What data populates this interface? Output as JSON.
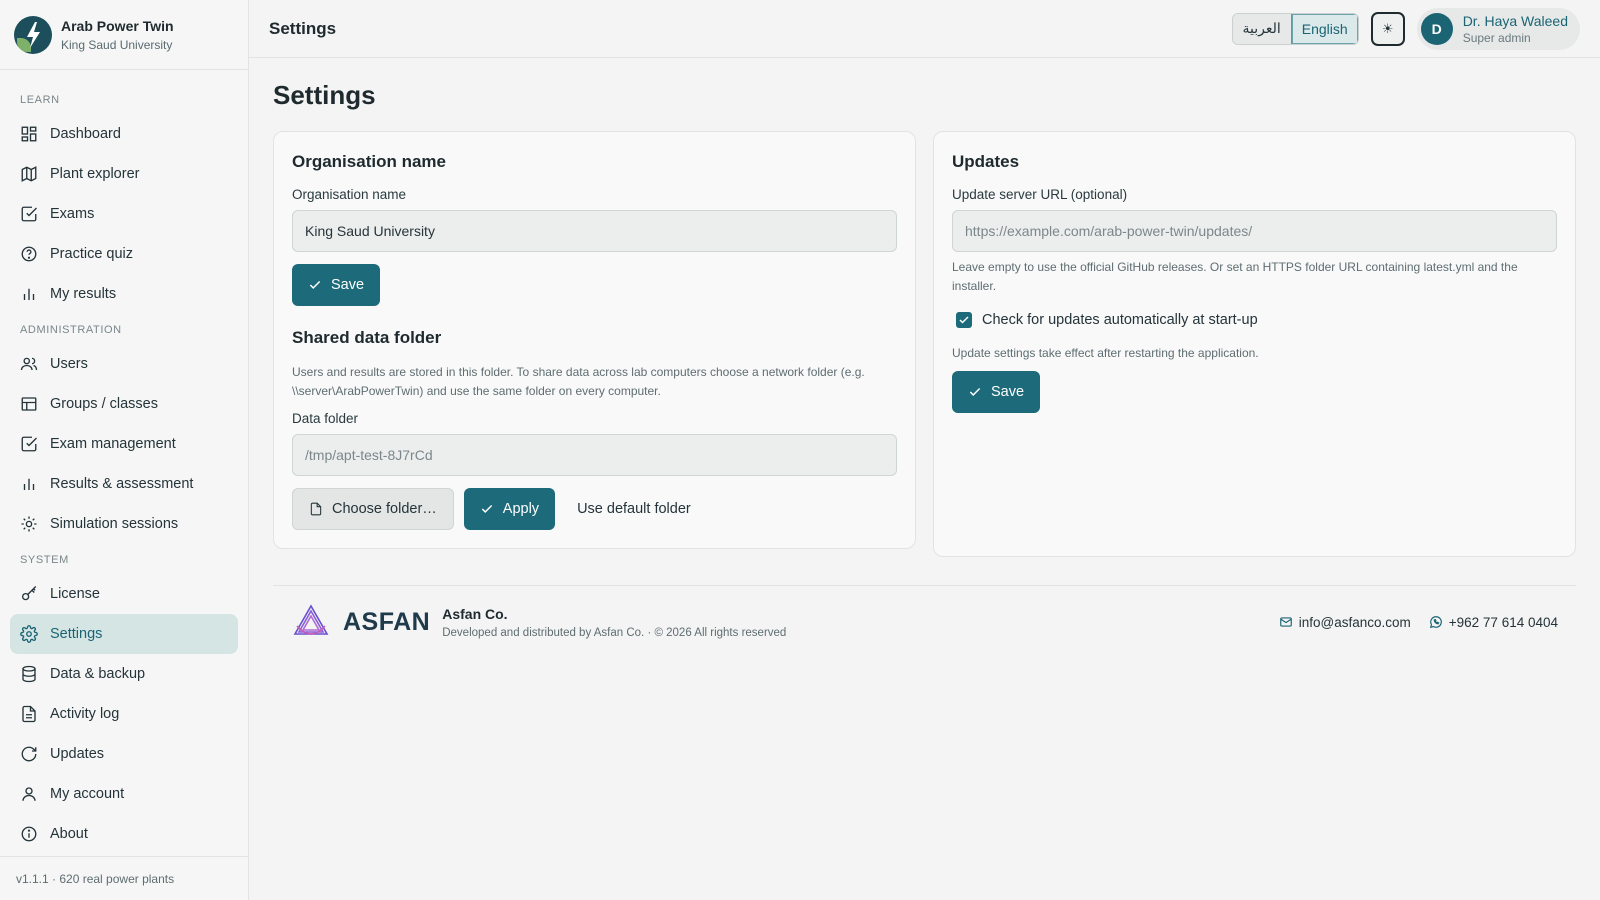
{
  "brand": {
    "title": "Arab Power Twin",
    "subtitle": "King Saud University"
  },
  "sidebar": {
    "sections": [
      {
        "label": "LEARN",
        "items": [
          "Dashboard",
          "Plant explorer",
          "Exams",
          "Practice quiz",
          "My results"
        ]
      },
      {
        "label": "ADMINISTRATION",
        "items": [
          "Users",
          "Groups / classes",
          "Exam management",
          "Results & assessment",
          "Simulation sessions"
        ]
      },
      {
        "label": "SYSTEM",
        "items": [
          "License",
          "Settings",
          "Data & backup",
          "Activity log",
          "Updates",
          "My account",
          "About"
        ]
      }
    ],
    "active_item": "Settings",
    "footer": "v1.1.1 · 620 real power plants"
  },
  "topbar": {
    "title": "Settings",
    "lang_arabic": "العربية",
    "lang_english": "English",
    "active_lang": "English",
    "theme_icon": "☀",
    "user_initial": "D",
    "user_name": "Dr. Haya Waleed",
    "user_role": "Super admin"
  },
  "page": {
    "title": "Settings"
  },
  "org_card": {
    "heading": "Organisation name",
    "field_label": "Organisation name",
    "field_value": "King Saud University",
    "save_label": "Save"
  },
  "data_folder": {
    "heading": "Shared data folder",
    "help": "Users and results are stored in this folder. To share data across lab computers choose a network folder (e.g. \\\\server\\ArabPowerTwin) and use the same folder on every computer.",
    "field_label": "Data folder",
    "field_value": "/tmp/apt-test-8J7rCd",
    "choose_label": "Choose folder…",
    "apply_label": "Apply",
    "default_label": "Use default folder"
  },
  "updates_card": {
    "heading": "Updates",
    "field_label": "Update server URL (optional)",
    "field_placeholder": "https://example.com/arab-power-twin/updates/",
    "help": "Leave empty to use the official GitHub releases. Or set an HTTPS folder URL containing latest.yml and the installer.",
    "checkbox_label": "Check for updates automatically at start-up",
    "checkbox_checked": true,
    "note": "Update settings take effect after restarting the application.",
    "save_label": "Save"
  },
  "footer": {
    "wordmark": "ASFAN",
    "company": "Asfan Co.",
    "copyright": "Developed and distributed by Asfan Co. · © 2026 All rights reserved",
    "email": "info@asfanco.com",
    "phone": "+962 77 614 0404"
  },
  "colors": {
    "accent": "#1c6a7a",
    "active_bg": "#d5e5e4",
    "background": "#f3f4f3"
  }
}
